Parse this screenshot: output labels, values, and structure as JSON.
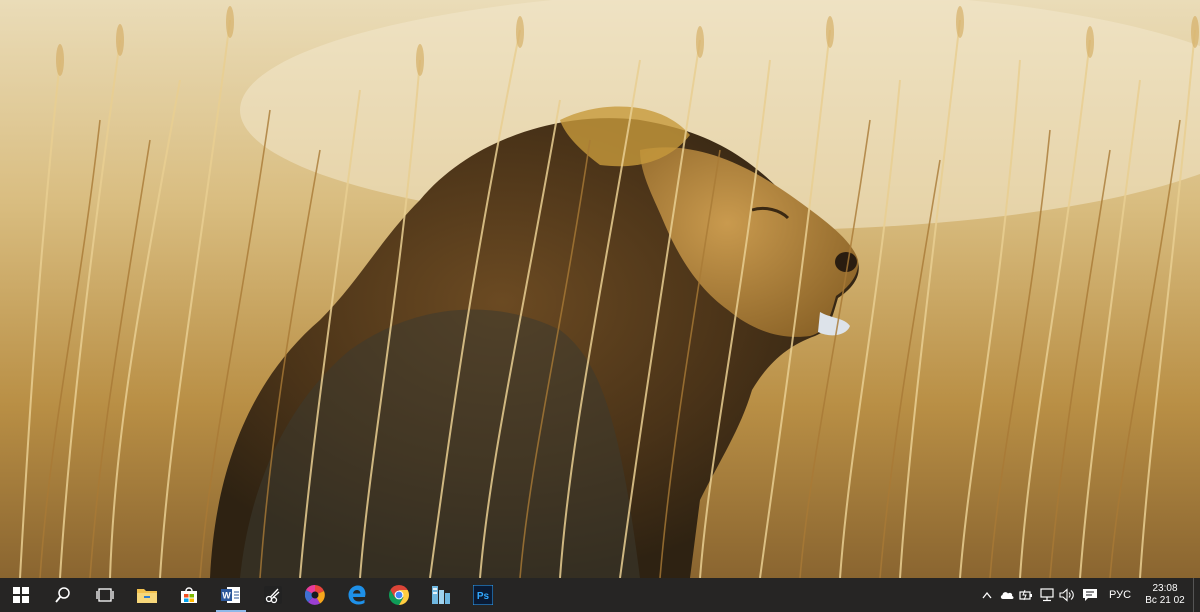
{
  "wallpaper": {
    "subject": "lion-in-tall-grass"
  },
  "taskbar": {
    "pinned": [
      {
        "name": "start-button",
        "icon": "windows-logo-icon"
      },
      {
        "name": "search-button",
        "icon": "search-icon"
      },
      {
        "name": "task-view-button",
        "icon": "task-view-icon"
      },
      {
        "name": "file-explorer-button",
        "icon": "folder-icon"
      },
      {
        "name": "store-button",
        "icon": "store-icon"
      },
      {
        "name": "word-button",
        "icon": "word-icon"
      },
      {
        "name": "scissors-app-button",
        "icon": "scissors-icon"
      },
      {
        "name": "color-app-button",
        "icon": "color-swirl-icon"
      },
      {
        "name": "edge-button",
        "icon": "edge-icon"
      },
      {
        "name": "chrome-button",
        "icon": "chrome-icon"
      },
      {
        "name": "network-app-button",
        "icon": "network-app-icon"
      },
      {
        "name": "photoshop-button",
        "icon": "photoshop-icon"
      }
    ],
    "word_letter": "W",
    "photoshop_label": "Ps",
    "tray": {
      "language": "РУС",
      "time": "23:08",
      "date": "Вс 21 02"
    }
  },
  "colors": {
    "taskbar_bg": "#181a1e",
    "accent": "#8fb8e8",
    "folder": "#f2c14e",
    "edge": "#1e90e8",
    "photoshop_bg": "#0a1a33",
    "photoshop_fg": "#31a8ff"
  }
}
